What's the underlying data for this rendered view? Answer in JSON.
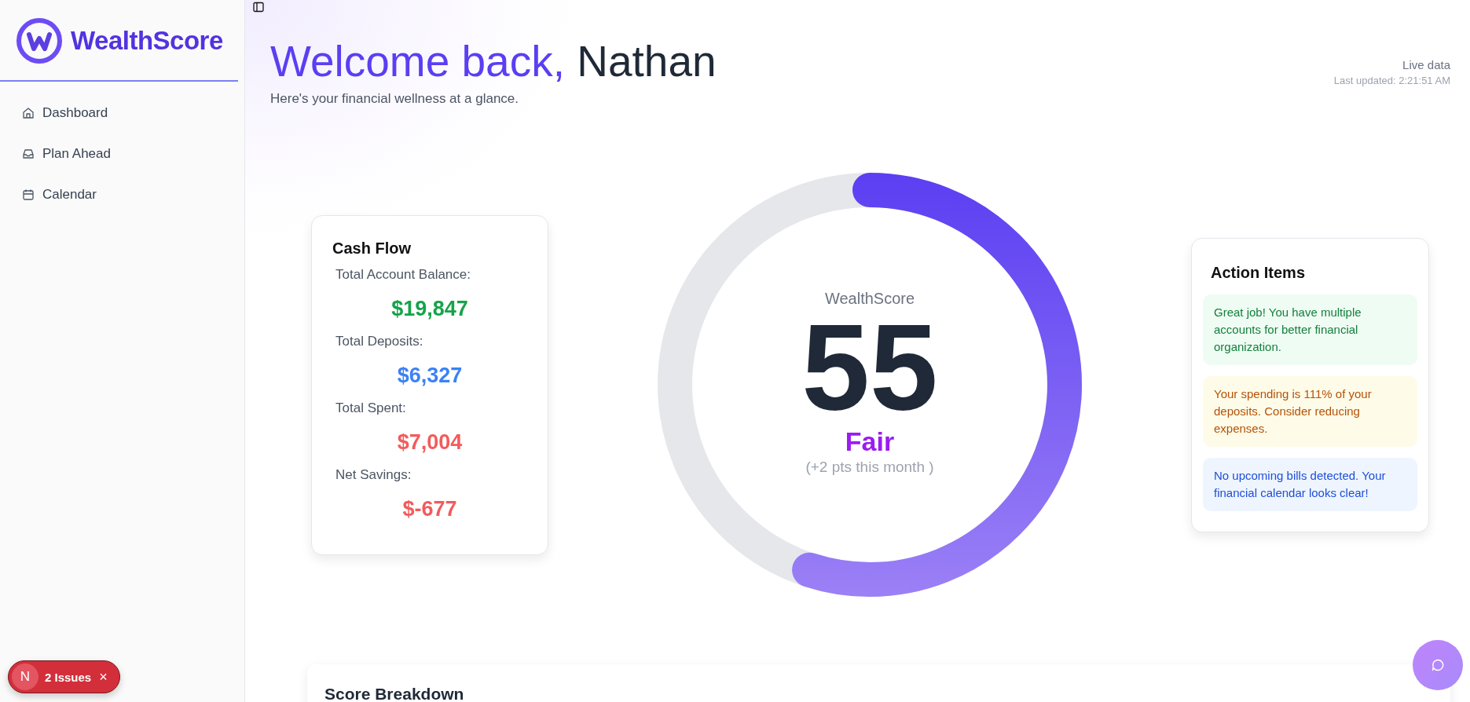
{
  "sidebar": {
    "logo": "WealthScore",
    "items": [
      {
        "label": "Dashboard",
        "selected": false
      },
      {
        "label": "Plan Ahead",
        "selected": false
      },
      {
        "label": "Calendar",
        "selected": false
      }
    ]
  },
  "header": {
    "greeting": "Welcome back,",
    "name": "Nathan",
    "subtitle": "Here's your financial wellness at a glance.",
    "status": "Live data",
    "updated": "Last updated: 2:21:51 AM"
  },
  "cash_flow": {
    "title": "Cash Flow",
    "rows": [
      {
        "label": "Total Account Balance:",
        "value": "$19,847",
        "color": "#16a34a"
      },
      {
        "label": "Total Deposits:",
        "value": "$6,327",
        "color": "#3b82f6"
      },
      {
        "label": "Total Spent:",
        "value": "$7,004",
        "color": "#f25c5c"
      },
      {
        "label": "Net Savings:",
        "value": "$-677",
        "color": "#f25c5c"
      }
    ]
  },
  "gauge": {
    "label": "WealthScore",
    "score": "55",
    "level": 0.55,
    "rating": "Fair",
    "change": "(+2 pts this month )"
  },
  "action_items": {
    "title": "Action Items",
    "items": [
      {
        "kind": "success",
        "text": "Great job! You have multiple accounts for better financial organization."
      },
      {
        "kind": "warning",
        "text": "Your spending is 111% of your deposits. Consider reducing expenses."
      },
      {
        "kind": "info",
        "text": "No upcoming bills detected. Your financial calendar looks clear!"
      }
    ]
  },
  "score_breakdown": {
    "title": "Score Breakdown"
  },
  "issues_badge": {
    "letter": "N",
    "label": "2 Issues",
    "close": "×"
  }
}
